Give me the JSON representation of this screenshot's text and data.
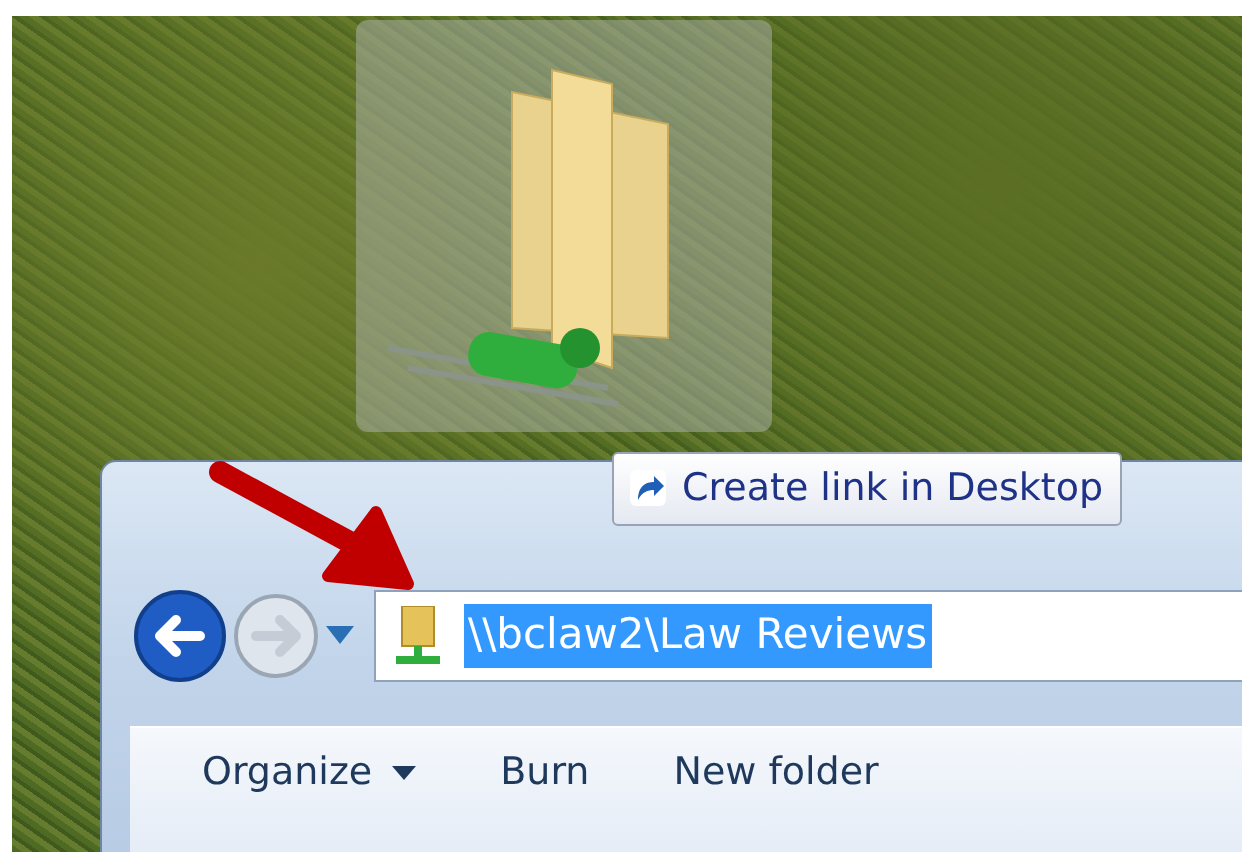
{
  "dragged_item": {
    "tooltip": "Create link in Desktop"
  },
  "navigation": {
    "back": {
      "disabled": false
    },
    "forward": {
      "disabled": true
    }
  },
  "address_bar": {
    "path": "\\\\bclaw2\\Law Reviews",
    "selected": true
  },
  "toolbar": [
    {
      "label": "Organize",
      "has_menu": true
    },
    {
      "label": "Burn",
      "has_menu": false
    },
    {
      "label": "New folder",
      "has_menu": false
    }
  ]
}
